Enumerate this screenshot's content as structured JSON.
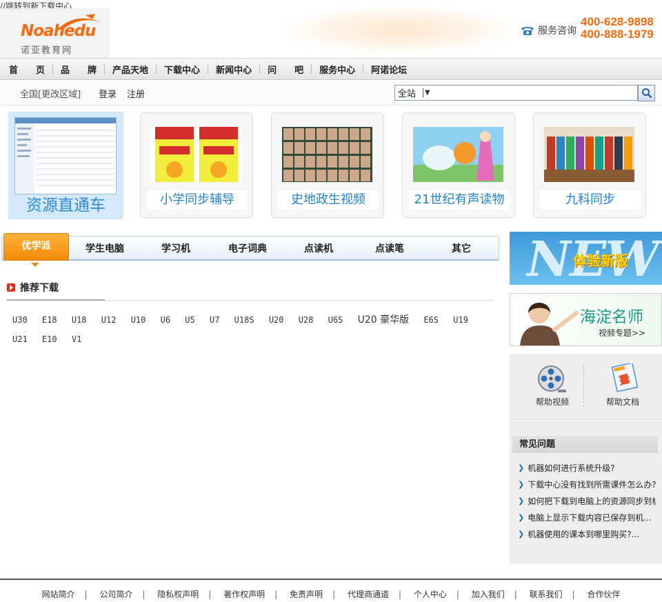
{
  "top_note": "//跳转到新下载中心",
  "logo": {
    "word": "Noahedu",
    "cn": "诺亚教育网"
  },
  "service": {
    "label": "服务咨询",
    "phones": [
      "400-628-9898",
      "400-888-1979"
    ]
  },
  "nav": [
    "首　　页",
    "品　　牌",
    "产品天地",
    "下载中心",
    "新闻中心",
    "问　　吧",
    "服务中心",
    "阿诺论坛"
  ],
  "subbar": {
    "region": "全国[更改区域]",
    "login": "登录",
    "register": "注册"
  },
  "search": {
    "scope": "全站",
    "caret": "▼",
    "value": ""
  },
  "cards": [
    "资源直通车",
    "小学同步辅导",
    "史地政生视频",
    "21世纪有声读物",
    "九科同步"
  ],
  "tabs": [
    "优学派",
    "学生电脑",
    "学习机",
    "电子词典",
    "点读机",
    "点读笔",
    "其它"
  ],
  "recommend": {
    "title": "推荐下载",
    "models": [
      "U30",
      "E18",
      "U18",
      "U12",
      "U10",
      "U6",
      "U5",
      "U7",
      "U18S",
      "U20",
      "U28",
      "U6S",
      "U20 豪华版",
      "E6S",
      "U19",
      "U21",
      "E10",
      "V1"
    ]
  },
  "side": {
    "new_bg": "NEW",
    "new_text": "体验新版",
    "teacher_title": "海淀名师",
    "teacher_sub": "视频专题>>",
    "help": [
      "帮助视频",
      "帮助文档"
    ]
  },
  "faq": {
    "title": "常见问题",
    "items": [
      "机器如何进行系统升级?",
      "下载中心没有找到所需课件怎么办?",
      "如何把下载到电脑上的资源同步到机器?",
      "电脑上显示下载内容已保存到机...",
      "机器使用的课本到哪里购买?..."
    ]
  },
  "footer": [
    "网站简介",
    "公司简介",
    "隐私权声明",
    "著作权声明",
    "免责声明",
    "代理商通道",
    "个人中心",
    "加入我们",
    "联系我们",
    "合作伙伴"
  ],
  "colors": {
    "brand": "#f26b10",
    "link": "#2780c8",
    "tab_active": "#f28a06"
  }
}
